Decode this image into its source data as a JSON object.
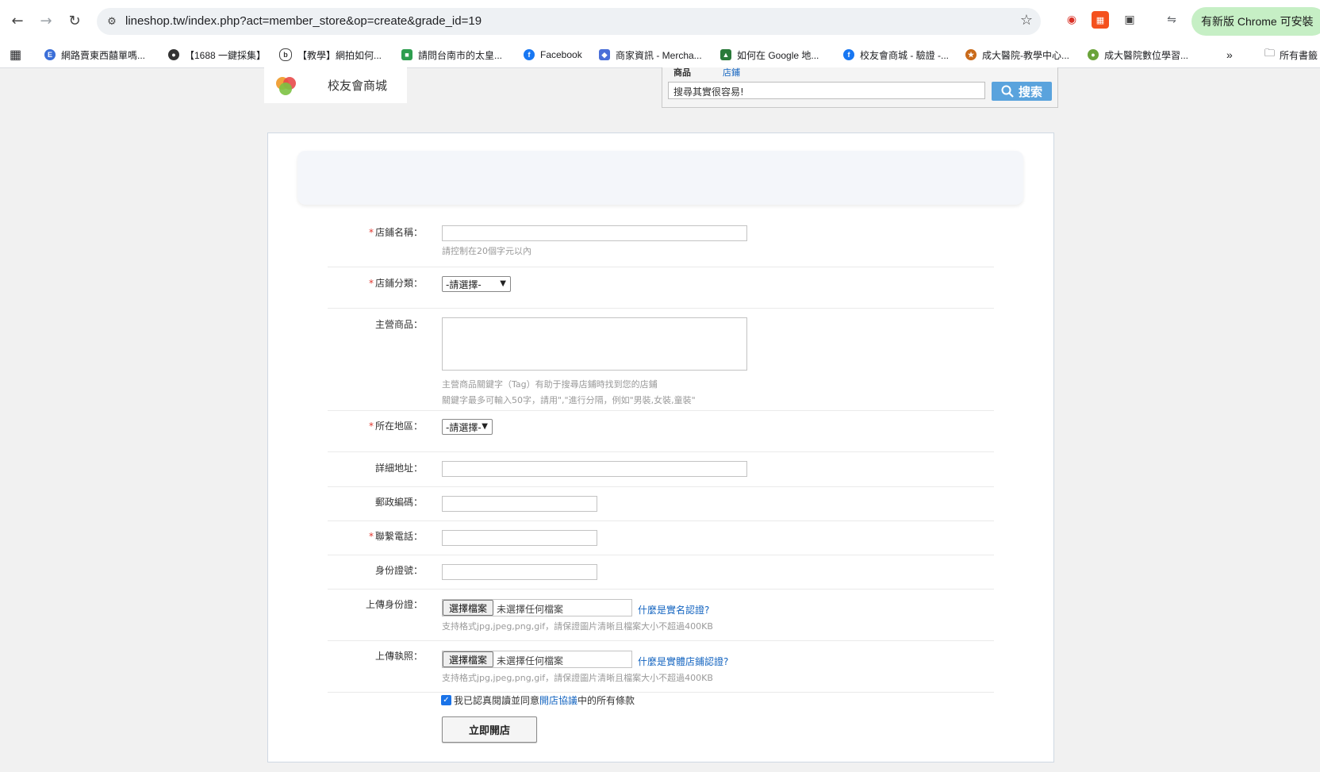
{
  "browser": {
    "url": "lineshop.tw/index.php?act=member_store&op=create&grade_id=19",
    "update_label": "有新版 Chrome 可安裝",
    "bookmarks": [
      {
        "label": "網路賣東西囍單嗎..."
      },
      {
        "label": "【1688 一鍵採集】"
      },
      {
        "label": "【教學】網拍如何..."
      },
      {
        "label": "請問台南市的太皇..."
      },
      {
        "label": "Facebook"
      },
      {
        "label": "商家資訊 - Mercha..."
      },
      {
        "label": "如何在 Google 地..."
      },
      {
        "label": "校友會商城 - 驗證 -..."
      },
      {
        "label": "成大醫院-教學中心..."
      },
      {
        "label": "成大醫院數位學習..."
      }
    ],
    "more_label": "»",
    "all_bookmarks_label": "所有書籤"
  },
  "header": {
    "site_name": "校友會商城",
    "search_tabs": [
      "商品",
      "店鋪"
    ],
    "search_placeholder": "搜尋其實很容易!",
    "search_button": "搜索"
  },
  "form": {
    "store_name": {
      "label": "店鋪名稱：",
      "hint": "請控制在20個字元以內"
    },
    "store_category": {
      "label": "店鋪分類：",
      "selected": "-請選擇-"
    },
    "main_products": {
      "label": "主營商品：",
      "hint1": "主營商品關鍵字（Tag）有助于搜尋店鋪時找到您的店鋪",
      "hint2": "關鍵字最多可輸入50字，請用\",\"進行分隔，例如\"男裝,女裝,童裝\""
    },
    "region": {
      "label": "所在地區：",
      "selected": "-請選擇-"
    },
    "address": {
      "label": "詳細地址："
    },
    "postcode": {
      "label": "郵政編碼："
    },
    "phone": {
      "label": "聯繫電話："
    },
    "id_number": {
      "label": "身份證號："
    },
    "upload_id": {
      "label": "上傳身份證：",
      "button": "選擇檔案",
      "status": "未選擇任何檔案",
      "link": "什麼是實名認證?",
      "hint": "支持格式jpg,jpeg,png,gif，請保證圖片清晰且檔案大小不超過400KB"
    },
    "upload_license": {
      "label": "上傳執照：",
      "button": "選擇檔案",
      "status": "未選擇任何檔案",
      "link": "什麼是實體店鋪認證?",
      "hint": "支持格式jpg,jpeg,png,gif，請保證圖片清晰且檔案大小不超過400KB"
    },
    "agree": {
      "prefix": "我已認真閱讀並同意",
      "link": "開店協議",
      "suffix": "中的所有條款",
      "checked": true
    },
    "submit": "立即開店"
  }
}
